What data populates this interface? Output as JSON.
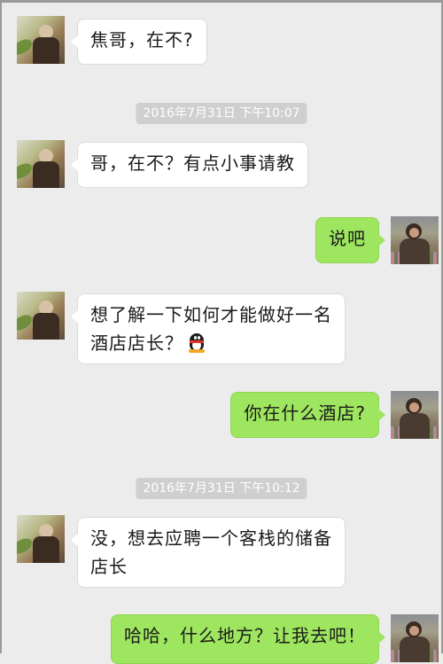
{
  "messages": [
    {
      "side": "left",
      "text": "焦哥，在不?"
    },
    {
      "timestamp": "2016年7月31日 下午10:07"
    },
    {
      "side": "left",
      "text": "哥，在不？有点小事请教"
    },
    {
      "side": "right",
      "text": "说吧"
    },
    {
      "side": "left",
      "line1": "想了解一下如何才能做好一名",
      "line2": "酒店店长？",
      "emoji": "qq-penguin-icon"
    },
    {
      "side": "right",
      "text": "你在什么酒店?"
    },
    {
      "timestamp": "2016年7月31日 下午10:12"
    },
    {
      "side": "left",
      "line1": "没，想去应聘一个客栈的储备",
      "line2": "店长"
    },
    {
      "side": "right",
      "text": "哈哈，什么地方？让我去吧！"
    }
  ],
  "colors": {
    "background": "#ececec",
    "bubble_left": "#ffffff",
    "bubble_right": "#9ee65f",
    "timestamp_bg": "#cfcfcf"
  }
}
